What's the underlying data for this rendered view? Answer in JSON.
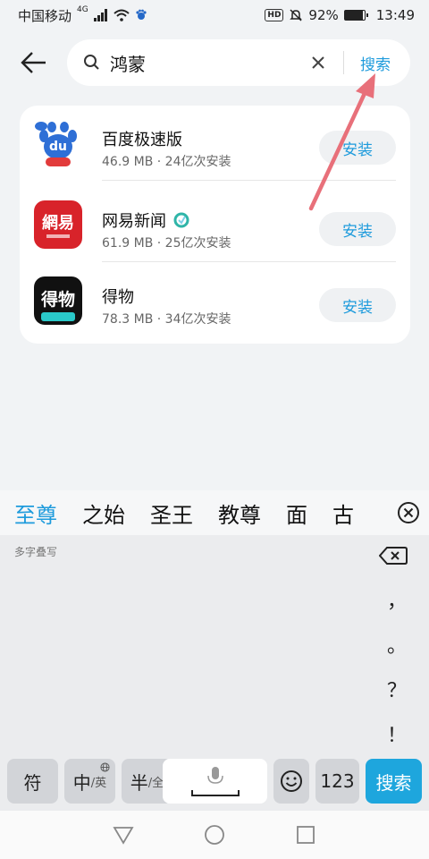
{
  "status_bar": {
    "carrier": "中国移动",
    "network": "4G",
    "battery": "92%",
    "battery_level": 0.92,
    "time": "13:49",
    "hd": "HD"
  },
  "search": {
    "query": "鸿蒙",
    "submit_label": "搜索"
  },
  "apps": [
    {
      "name": "百度极速版",
      "meta": "46.9 MB · 24亿次安装",
      "install_label": "安装",
      "icon": "baidu-icon",
      "icon_text": "du"
    },
    {
      "name": "网易新闻",
      "meta": "61.9 MB · 25亿次安装",
      "install_label": "安装",
      "icon": "netease-icon",
      "icon_text": "網易"
    },
    {
      "name": "得物",
      "meta": "78.3 MB · 34亿次安装",
      "install_label": "安装",
      "icon": "dewu-icon",
      "icon_text": "得物"
    }
  ],
  "keyboard": {
    "candidates": [
      "至尊",
      "之始",
      "圣王",
      "教尊",
      "面",
      "古"
    ],
    "handwrite_label": "多字叠写",
    "punctuation": [
      "，",
      "。",
      "？",
      "！"
    ],
    "keys": {
      "symbol": "符",
      "chinese_main": "中",
      "chinese_sub": "/英",
      "half_main": "半",
      "half_sub": "/全",
      "numbers": "123",
      "search": "搜索"
    }
  },
  "colors": {
    "accent": "#1e9bdc",
    "annotation": "#e8707a"
  }
}
